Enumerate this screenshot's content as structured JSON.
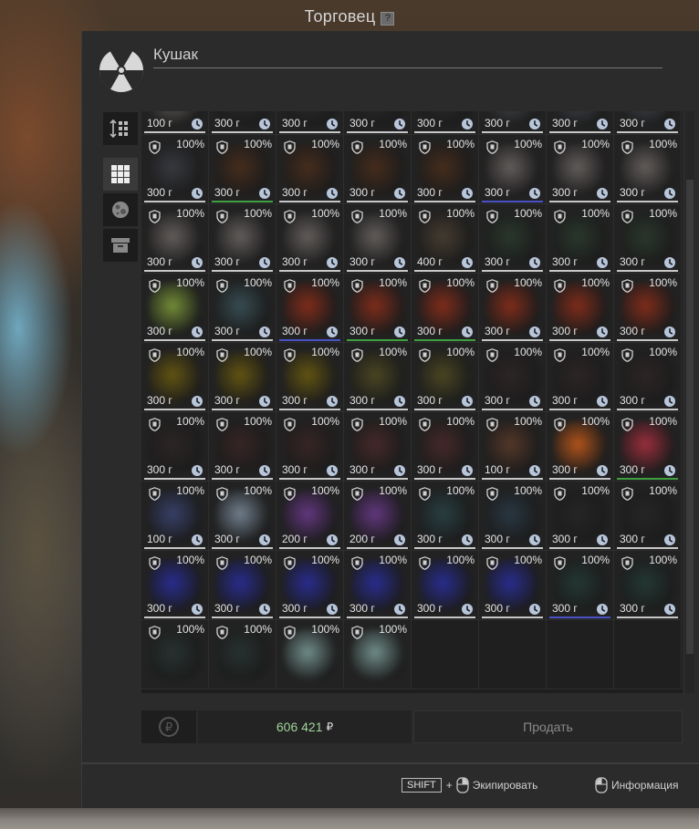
{
  "title": "Торговец",
  "help_label": "?",
  "trader_name": "Кушак",
  "items": [
    {
      "pct": "",
      "weight": "100 г",
      "color": "#6e6a63",
      "shield": false,
      "line": "white"
    },
    {
      "pct": "",
      "weight": "300 г",
      "color": "#2c2c2c",
      "shield": false,
      "line": "white"
    },
    {
      "pct": "",
      "weight": "300 г",
      "color": "#2c2c2c",
      "shield": false,
      "line": "white"
    },
    {
      "pct": "",
      "weight": "300 г",
      "color": "#2c2c2c",
      "shield": false,
      "line": "white"
    },
    {
      "pct": "",
      "weight": "300 г",
      "color": "#2c2c2c",
      "shield": false,
      "line": "white"
    },
    {
      "pct": "",
      "weight": "300 г",
      "color": "#4c4f56",
      "shield": false,
      "line": "white"
    },
    {
      "pct": "",
      "weight": "300 г",
      "color": "#474c55",
      "shield": false,
      "line": "white"
    },
    {
      "pct": "",
      "weight": "300 г",
      "color": "#474c55",
      "shield": false,
      "line": "white"
    },
    {
      "pct": "100%",
      "weight": "300 г",
      "color": "#3a3c42",
      "shield": true,
      "line": "white"
    },
    {
      "pct": "100%",
      "weight": "300 г",
      "color": "#4a2e1c",
      "shield": true,
      "line": "green"
    },
    {
      "pct": "100%",
      "weight": "300 г",
      "color": "#4a2e1c",
      "shield": true,
      "line": "white"
    },
    {
      "pct": "100%",
      "weight": "300 г",
      "color": "#4a2e1c",
      "shield": true,
      "line": "white"
    },
    {
      "pct": "100%",
      "weight": "300 г",
      "color": "#4a2e1c",
      "shield": true,
      "line": "white"
    },
    {
      "pct": "100%",
      "weight": "300 г",
      "color": "#6a6462",
      "shield": true,
      "line": "blue"
    },
    {
      "pct": "100%",
      "weight": "300 г",
      "color": "#6a6462",
      "shield": true,
      "line": "white"
    },
    {
      "pct": "100%",
      "weight": "300 г",
      "color": "#6a6462",
      "shield": true,
      "line": "white"
    },
    {
      "pct": "100%",
      "weight": "300 г",
      "color": "#6a6462",
      "shield": true,
      "line": "white"
    },
    {
      "pct": "100%",
      "weight": "300 г",
      "color": "#6a6462",
      "shield": true,
      "line": "white"
    },
    {
      "pct": "100%",
      "weight": "300 г",
      "color": "#6a6462",
      "shield": true,
      "line": "white"
    },
    {
      "pct": "100%",
      "weight": "300 г",
      "color": "#6a6462",
      "shield": true,
      "line": "white"
    },
    {
      "pct": "100%",
      "weight": "400 г",
      "color": "#4a3f33",
      "shield": true,
      "line": "white"
    },
    {
      "pct": "100%",
      "weight": "300 г",
      "color": "#2b3a2e",
      "shield": true,
      "line": "white"
    },
    {
      "pct": "100%",
      "weight": "300 г",
      "color": "#2b3a2e",
      "shield": true,
      "line": "white"
    },
    {
      "pct": "100%",
      "weight": "300 г",
      "color": "#2b3a2e",
      "shield": true,
      "line": "white"
    },
    {
      "pct": "100%",
      "weight": "300 г",
      "color": "#7d9a3a",
      "shield": true,
      "line": "white"
    },
    {
      "pct": "100%",
      "weight": "300 г",
      "color": "#3a5258",
      "shield": true,
      "line": "white"
    },
    {
      "pct": "100%",
      "weight": "300 г",
      "color": "#8a2e1a",
      "shield": true,
      "line": "blue"
    },
    {
      "pct": "100%",
      "weight": "300 г",
      "color": "#8a2e1a",
      "shield": true,
      "line": "green"
    },
    {
      "pct": "100%",
      "weight": "300 г",
      "color": "#8a2e1a",
      "shield": true,
      "line": "green"
    },
    {
      "pct": "100%",
      "weight": "300 г",
      "color": "#8a2e1a",
      "shield": true,
      "line": "white"
    },
    {
      "pct": "100%",
      "weight": "300 г",
      "color": "#8a2e1a",
      "shield": true,
      "line": "white"
    },
    {
      "pct": "100%",
      "weight": "300 г",
      "color": "#8a2e1a",
      "shield": true,
      "line": "white"
    },
    {
      "pct": "100%",
      "weight": "300 г",
      "color": "#6a5a10",
      "shield": true,
      "line": "white"
    },
    {
      "pct": "100%",
      "weight": "300 г",
      "color": "#6a5a10",
      "shield": true,
      "line": "white"
    },
    {
      "pct": "100%",
      "weight": "300 г",
      "color": "#6a5a10",
      "shield": true,
      "line": "white"
    },
    {
      "pct": "100%",
      "weight": "300 г",
      "color": "#4e4a22",
      "shield": true,
      "line": "white"
    },
    {
      "pct": "100%",
      "weight": "300 г",
      "color": "#4e4a22",
      "shield": true,
      "line": "white"
    },
    {
      "pct": "100%",
      "weight": "300 г",
      "color": "#2e2626",
      "shield": true,
      "line": "white"
    },
    {
      "pct": "100%",
      "weight": "300 г",
      "color": "#2e2626",
      "shield": true,
      "line": "white"
    },
    {
      "pct": "100%",
      "weight": "300 г",
      "color": "#2e2626",
      "shield": true,
      "line": "white"
    },
    {
      "pct": "100%",
      "weight": "300 г",
      "color": "#2e2626",
      "shield": true,
      "line": "white"
    },
    {
      "pct": "100%",
      "weight": "300 г",
      "color": "#3a2626",
      "shield": true,
      "line": "white"
    },
    {
      "pct": "100%",
      "weight": "300 г",
      "color": "#3a2626",
      "shield": true,
      "line": "white"
    },
    {
      "pct": "100%",
      "weight": "300 г",
      "color": "#4a2a2a",
      "shield": true,
      "line": "white"
    },
    {
      "pct": "100%",
      "weight": "300 г",
      "color": "#4a2a2a",
      "shield": true,
      "line": "white"
    },
    {
      "pct": "100%",
      "weight": "100 г",
      "color": "#5a3a2a",
      "shield": true,
      "line": "white"
    },
    {
      "pct": "100%",
      "weight": "300 г",
      "color": "#c25a1a",
      "shield": true,
      "line": "white"
    },
    {
      "pct": "100%",
      "weight": "300 г",
      "color": "#a83040",
      "shield": true,
      "line": "green"
    },
    {
      "pct": "100%",
      "weight": "100 г",
      "color": "#3a4470",
      "shield": true,
      "line": "white"
    },
    {
      "pct": "100%",
      "weight": "300 г",
      "color": "#7a8a9a",
      "shield": true,
      "line": "white"
    },
    {
      "pct": "100%",
      "weight": "200 г",
      "color": "#6a3a8a",
      "shield": true,
      "line": "white"
    },
    {
      "pct": "100%",
      "weight": "200 г",
      "color": "#6a3a8a",
      "shield": true,
      "line": "white"
    },
    {
      "pct": "100%",
      "weight": "300 г",
      "color": "#2a4246",
      "shield": true,
      "line": "white"
    },
    {
      "pct": "100%",
      "weight": "300 г",
      "color": "#2a3a46",
      "shield": true,
      "line": "white"
    },
    {
      "pct": "100%",
      "weight": "300 г",
      "color": "#262626",
      "shield": true,
      "line": "white"
    },
    {
      "pct": "100%",
      "weight": "300 г",
      "color": "#262626",
      "shield": true,
      "line": "white"
    },
    {
      "pct": "100%",
      "weight": "300 г",
      "color": "#2a2e9a",
      "shield": true,
      "line": "white"
    },
    {
      "pct": "100%",
      "weight": "300 г",
      "color": "#2a2e9a",
      "shield": true,
      "line": "white"
    },
    {
      "pct": "100%",
      "weight": "300 г",
      "color": "#2a2e9a",
      "shield": true,
      "line": "white"
    },
    {
      "pct": "100%",
      "weight": "300 г",
      "color": "#2a2e9a",
      "shield": true,
      "line": "white"
    },
    {
      "pct": "100%",
      "weight": "300 г",
      "color": "#2a2e9a",
      "shield": true,
      "line": "white"
    },
    {
      "pct": "100%",
      "weight": "300 г",
      "color": "#2a2e9a",
      "shield": true,
      "line": "white"
    },
    {
      "pct": "100%",
      "weight": "300 г",
      "color": "#243a36",
      "shield": true,
      "line": "blue"
    },
    {
      "pct": "100%",
      "weight": "300 г",
      "color": "#243a36",
      "shield": true,
      "line": "white"
    },
    {
      "pct": "100%",
      "weight": "",
      "color": "#283432",
      "shield": true,
      "line": "none"
    },
    {
      "pct": "100%",
      "weight": "",
      "color": "#283432",
      "shield": true,
      "line": "none"
    },
    {
      "pct": "100%",
      "weight": "",
      "color": "#7a9a96",
      "shield": true,
      "line": "none"
    },
    {
      "pct": "100%",
      "weight": "",
      "color": "#7a9a96",
      "shield": true,
      "line": "none"
    },
    {
      "empty": true
    },
    {
      "empty": true
    },
    {
      "empty": true
    },
    {
      "empty": true
    }
  ],
  "footer": {
    "money": "606 421",
    "currency": "₽",
    "sell_label": "Продать"
  },
  "hints": {
    "shift_key": "SHIFT",
    "plus": "+",
    "equip_label": "Экипировать",
    "info_label": "Информация"
  },
  "colors": {
    "money": "#9fd69a",
    "quality_blue": "#4a52c8",
    "quality_green": "#3fa040"
  }
}
